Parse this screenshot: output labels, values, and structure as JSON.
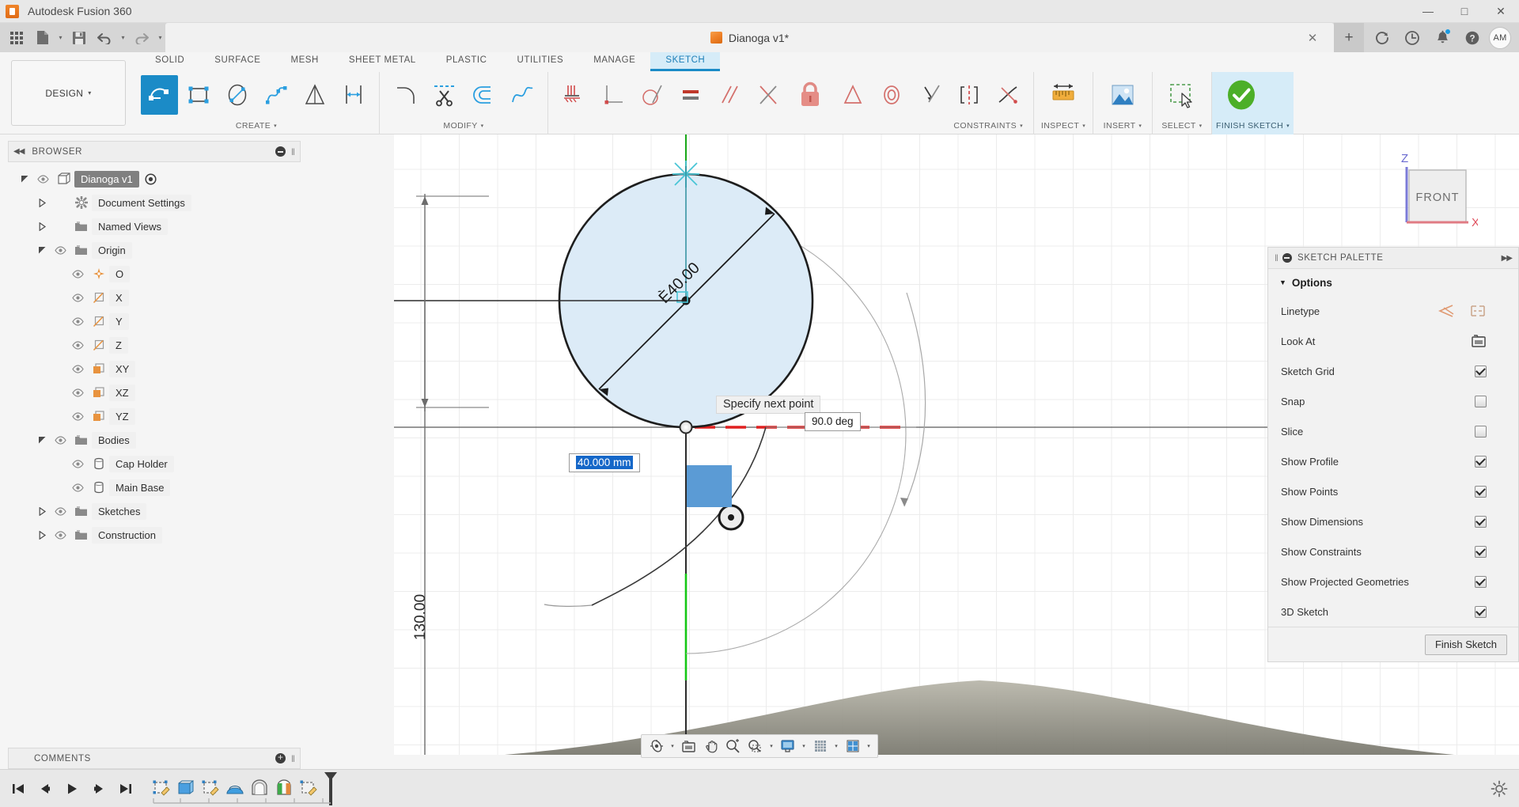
{
  "window": {
    "app_title": "Autodesk Fusion 360",
    "app_logo_icon": "fusion-logo-icon",
    "minimize_label": "—",
    "maximize_label": "□",
    "close_label": "✕"
  },
  "quick_access": {
    "grid_icon": "app-grid-icon",
    "new_icon": "new-document-icon",
    "save_icon": "save-icon",
    "undo_icon": "undo-icon",
    "redo_icon": "redo-icon",
    "caret": "▾",
    "document_tab": {
      "label": "Dianoga v1*",
      "cube_icon": "document-cube-icon",
      "close_label": "✕"
    },
    "new_tab_label": "+",
    "right_icons": [
      {
        "name": "refresh-icon",
        "glyph": "↻"
      },
      {
        "name": "job-status-clock-icon",
        "glyph": "◷"
      },
      {
        "name": "notifications-bell-icon",
        "glyph": "🔔"
      },
      {
        "name": "help-icon",
        "glyph": "?"
      }
    ],
    "avatar_initials": "AM"
  },
  "ribbon": {
    "workspace": {
      "label": "DESIGN",
      "caret": "▾"
    },
    "tabs": [
      {
        "label": "SOLID",
        "active": false
      },
      {
        "label": "SURFACE",
        "active": false
      },
      {
        "label": "MESH",
        "active": false
      },
      {
        "label": "SHEET METAL",
        "active": false
      },
      {
        "label": "PLASTIC",
        "active": false
      },
      {
        "label": "UTILITIES",
        "active": false
      },
      {
        "label": "MANAGE",
        "active": false
      },
      {
        "label": "SKETCH",
        "active": true
      }
    ],
    "panels": [
      {
        "name": "CREATE",
        "caret": "▾",
        "tools": [
          {
            "name": "tool-line",
            "selected": true
          },
          {
            "name": "tool-rectangle",
            "selected": false
          },
          {
            "name": "tool-circle",
            "selected": false
          },
          {
            "name": "tool-arc",
            "selected": false
          },
          {
            "name": "tool-polygon",
            "selected": false
          },
          {
            "name": "tool-sketch-dimension",
            "selected": false
          }
        ]
      },
      {
        "name": "MODIFY",
        "caret": "▾",
        "tools": [
          {
            "name": "tool-fillet",
            "selected": false
          },
          {
            "name": "tool-trim",
            "selected": false
          },
          {
            "name": "tool-offset",
            "selected": false
          },
          {
            "name": "tool-curvature-comb",
            "selected": false
          }
        ]
      },
      {
        "name": "CONSTRAINTS",
        "caret": "▾",
        "tools": [
          {
            "name": "constraint-coincident",
            "selected": false
          },
          {
            "name": "constraint-perpendicular",
            "selected": false
          },
          {
            "name": "constraint-tangent",
            "selected": false
          },
          {
            "name": "constraint-equal",
            "selected": false
          },
          {
            "name": "constraint-parallel",
            "selected": false
          },
          {
            "name": "constraint-symmetry",
            "selected": false
          },
          {
            "name": "constraint-fix-unfix",
            "selected": false
          },
          {
            "name": "constraint-midpoint",
            "selected": false
          },
          {
            "name": "constraint-concentric",
            "selected": false
          },
          {
            "name": "constraint-collinear",
            "selected": false
          },
          {
            "name": "constraint-horizontal-vertical",
            "selected": false
          },
          {
            "name": "constraint-curvature",
            "selected": false
          }
        ]
      },
      {
        "name": "INSPECT",
        "caret": "▾",
        "tools": [
          {
            "name": "tool-measure",
            "selected": false
          }
        ]
      },
      {
        "name": "INSERT",
        "caret": "▾",
        "tools": [
          {
            "name": "tool-insert-image",
            "selected": false
          }
        ]
      },
      {
        "name": "SELECT",
        "caret": "▾",
        "tools": [
          {
            "name": "tool-select-window",
            "selected": false
          }
        ]
      },
      {
        "name": "FINISH SKETCH",
        "caret": "▾",
        "tools": [
          {
            "name": "tool-finish-sketch",
            "selected": false
          }
        ]
      }
    ]
  },
  "browser": {
    "title": "BROWSER",
    "collapse_icon": "collapse-left-icon",
    "minimize_icon": "minimize-icon",
    "grip_icon": "resize-grip-icon",
    "tree": [
      {
        "label": "Dianoga v1",
        "icon": "component-icon",
        "indent": 0,
        "arrow": "expanded",
        "eye": true,
        "selected": true,
        "trailing_icon": "activate-component-icon"
      },
      {
        "label": "Document Settings",
        "icon": "gear-icon",
        "indent": 1,
        "arrow": "collapsed",
        "eye": false,
        "selected": false
      },
      {
        "label": "Named Views",
        "icon": "folder-icon",
        "indent": 1,
        "arrow": "collapsed",
        "eye": false,
        "selected": false
      },
      {
        "label": "Origin",
        "icon": "folder-icon",
        "indent": 1,
        "arrow": "expanded",
        "eye": true,
        "selected": false
      },
      {
        "label": "O",
        "icon": "origin-point-icon",
        "indent": 2,
        "arrow": "none",
        "eye": true,
        "selected": false
      },
      {
        "label": "X",
        "icon": "axis-icon",
        "indent": 2,
        "arrow": "none",
        "eye": true,
        "selected": false
      },
      {
        "label": "Y",
        "icon": "axis-icon",
        "indent": 2,
        "arrow": "none",
        "eye": true,
        "selected": false
      },
      {
        "label": "Z",
        "icon": "axis-icon",
        "indent": 2,
        "arrow": "none",
        "eye": true,
        "selected": false
      },
      {
        "label": "XY",
        "icon": "plane-icon",
        "indent": 2,
        "arrow": "none",
        "eye": true,
        "selected": false
      },
      {
        "label": "XZ",
        "icon": "plane-icon",
        "indent": 2,
        "arrow": "none",
        "eye": true,
        "selected": false
      },
      {
        "label": "YZ",
        "icon": "plane-icon",
        "indent": 2,
        "arrow": "none",
        "eye": true,
        "selected": false
      },
      {
        "label": "Bodies",
        "icon": "folder-icon",
        "indent": 1,
        "arrow": "expanded",
        "eye": true,
        "selected": false
      },
      {
        "label": "Cap Holder",
        "icon": "body-icon",
        "indent": 2,
        "arrow": "none",
        "eye": true,
        "selected": false
      },
      {
        "label": "Main Base",
        "icon": "body-icon",
        "indent": 2,
        "arrow": "none",
        "eye": true,
        "selected": false
      },
      {
        "label": "Sketches",
        "icon": "folder-icon",
        "indent": 1,
        "arrow": "collapsed",
        "eye": true,
        "selected": false
      },
      {
        "label": "Construction",
        "icon": "folder-icon",
        "indent": 1,
        "arrow": "collapsed",
        "eye": true,
        "selected": false
      }
    ]
  },
  "comments": {
    "title": "COMMENTS",
    "add_icon": "add-comment-icon",
    "grip_icon": "resize-grip-icon"
  },
  "canvas": {
    "tooltip": "Specify next point",
    "angle_field": "90.0 deg",
    "length_field": "40.000 mm",
    "diameter_dimension": "Ѐ40.00",
    "height_dimension": "130.00",
    "viewcube_face": "FRONT",
    "axis_z_label": "Z",
    "axis_x_label": "X",
    "profile_fill": "#dcebf7",
    "constraint_color": "#e32020",
    "guide_color": "#19c219",
    "cursor_square_color": "#5b9bd5"
  },
  "navbar": {
    "buttons": [
      {
        "name": "orbit-icon",
        "caret": true
      },
      {
        "name": "look-at-icon",
        "caret": false
      },
      {
        "name": "pan-icon",
        "caret": false
      },
      {
        "name": "zoom-icon",
        "caret": false
      },
      {
        "name": "zoom-window-icon",
        "caret": true
      },
      {
        "name": "display-settings-icon",
        "caret": true
      },
      {
        "name": "grid-snap-icon",
        "caret": true
      },
      {
        "name": "viewports-icon",
        "caret": true
      }
    ],
    "caret": "▾"
  },
  "timeline": {
    "playback": [
      {
        "name": "go-to-beginning-icon",
        "glyph": "⏮"
      },
      {
        "name": "step-back-icon",
        "glyph": "◀"
      },
      {
        "name": "play-icon",
        "glyph": "▶"
      },
      {
        "name": "step-forward-icon",
        "glyph": "▶"
      },
      {
        "name": "go-to-end-icon",
        "glyph": "⏭"
      }
    ],
    "features": [
      {
        "name": "timeline-sketch-icon"
      },
      {
        "name": "timeline-extrude-icon"
      },
      {
        "name": "timeline-sketch-2-icon"
      },
      {
        "name": "timeline-revolve-icon"
      },
      {
        "name": "timeline-shell-icon"
      },
      {
        "name": "timeline-appearance-icon"
      },
      {
        "name": "timeline-sketch-3-icon"
      }
    ],
    "marker_name": "timeline-end-marker",
    "settings_icon": "settings-gear-icon"
  }
}
